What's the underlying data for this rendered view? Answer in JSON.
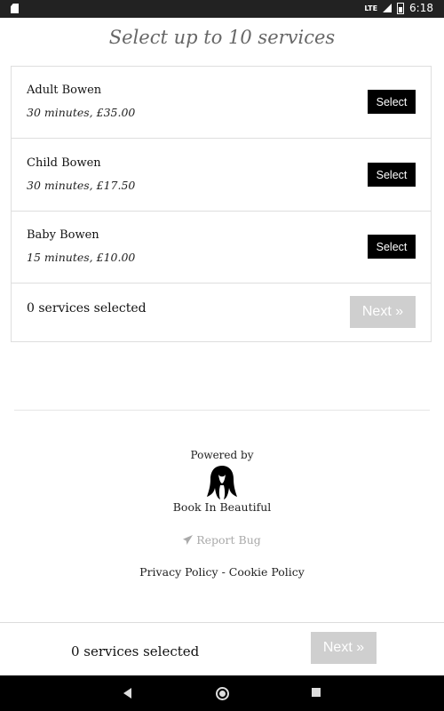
{
  "status_bar": {
    "network": "LTE",
    "time": "6:18",
    "icons": [
      "sim-card-icon",
      "signal-icon",
      "battery-icon"
    ]
  },
  "page_title": "Select up to 10 services",
  "services": [
    {
      "name": "Adult Bowen",
      "meta": "30 minutes, £35.00",
      "button": "Select"
    },
    {
      "name": "Child Bowen",
      "meta": "30 minutes, £17.50",
      "button": "Select"
    },
    {
      "name": "Baby Bowen",
      "meta": "15 minutes, £10.00",
      "button": "Select"
    }
  ],
  "summary": {
    "selected_text": "0 services selected",
    "next_label": "Next »"
  },
  "footer": {
    "powered_by": "Powered by",
    "brand": "Book In Beautiful",
    "report_bug": "Report Bug",
    "privacy": "Privacy Policy",
    "separator": " - ",
    "cookie": "Cookie Policy"
  },
  "bottom_bar": {
    "selected_text": "0 services selected",
    "next_label": "Next »"
  },
  "colors": {
    "button_bg": "#000000",
    "disabled_bg": "#cfcfcf",
    "muted_text": "#aaaaaa"
  }
}
